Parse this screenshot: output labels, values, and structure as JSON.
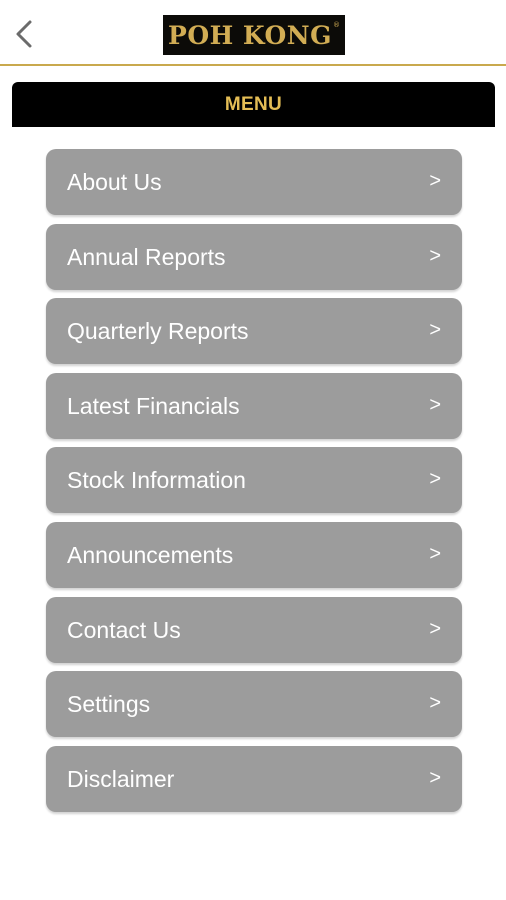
{
  "header": {
    "back_icon": "chevron-left-icon",
    "logo_text": "POH KONG",
    "logo_mark": "®"
  },
  "menu": {
    "title": "MENU",
    "items": [
      {
        "label": "About Us",
        "chevron": ">"
      },
      {
        "label": "Annual Reports",
        "chevron": ">"
      },
      {
        "label": "Quarterly Reports",
        "chevron": ">"
      },
      {
        "label": "Latest Financials",
        "chevron": ">"
      },
      {
        "label": "Stock Information",
        "chevron": ">"
      },
      {
        "label": "Announcements",
        "chevron": ">"
      },
      {
        "label": "Contact Us",
        "chevron": ">"
      },
      {
        "label": "Settings",
        "chevron": ">"
      },
      {
        "label": "Disclaimer",
        "chevron": ">"
      }
    ]
  },
  "colors": {
    "accent_gold": "#d2ad54",
    "menu_bar": "#000000",
    "item_background": "#9c9c9c",
    "header_divider": "#c9a94d"
  }
}
